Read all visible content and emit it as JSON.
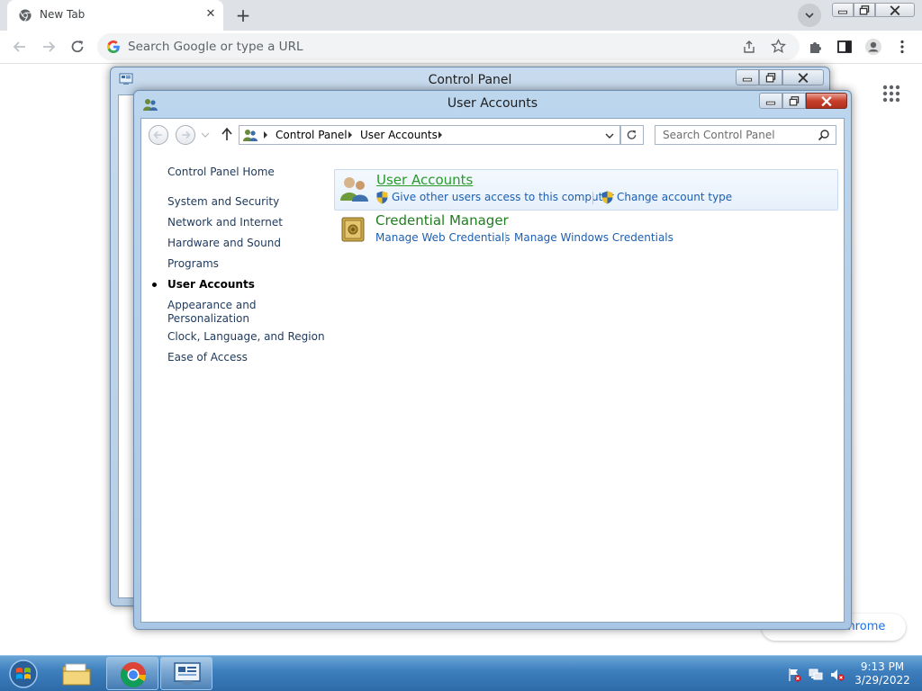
{
  "browser": {
    "tab": {
      "title": "New Tab",
      "close_glyph": "✕"
    },
    "new_tab_glyph": "+",
    "omnibox": {
      "placeholder": "Search Google or type a URL"
    },
    "ntp": {
      "customize_label": "Customize Chrome"
    },
    "icons": [
      "chrome-favicon",
      "back-icon",
      "forward-icon",
      "reload-icon",
      "google-g-icon",
      "share-icon",
      "star-icon",
      "extensions-icon",
      "side-panel-icon",
      "profile-icon",
      "menu-icon",
      "apps-grid-icon"
    ]
  },
  "control_panel_back": {
    "title": "Control Panel"
  },
  "user_accounts_window": {
    "title": "User Accounts",
    "breadcrumb": [
      "Control Panel",
      "User Accounts"
    ],
    "search": {
      "placeholder": "Search Control Panel"
    },
    "left_nav": [
      {
        "label": "Control Panel Home",
        "current": false
      },
      {
        "label": "System and Security",
        "current": false
      },
      {
        "label": "Network and Internet",
        "current": false
      },
      {
        "label": "Hardware and Sound",
        "current": false
      },
      {
        "label": "Programs",
        "current": false
      },
      {
        "label": "User Accounts",
        "current": true
      },
      {
        "label": "Appearance and Personalization",
        "current": false
      },
      {
        "label": "Clock, Language, and Region",
        "current": false
      },
      {
        "label": "Ease of Access",
        "current": false
      }
    ],
    "categories": [
      {
        "title": "User Accounts",
        "links": [
          {
            "label": "Give other users access to this computer",
            "shield": true
          },
          {
            "label": "Change account type",
            "shield": true
          }
        ]
      },
      {
        "title": "Credential Manager",
        "links": [
          {
            "label": "Manage Web Credentials",
            "shield": false
          },
          {
            "label": "Manage Windows Credentials",
            "shield": false
          }
        ]
      }
    ]
  },
  "taskbar": {
    "clock": {
      "time": "9:13 PM",
      "date": "3/29/2022"
    }
  },
  "colors": {
    "aero_frame": "#a9c6e4",
    "link_blue": "#1d5fb0",
    "category_green": "#1e7d1e",
    "taskbar": "#3f80bf"
  }
}
